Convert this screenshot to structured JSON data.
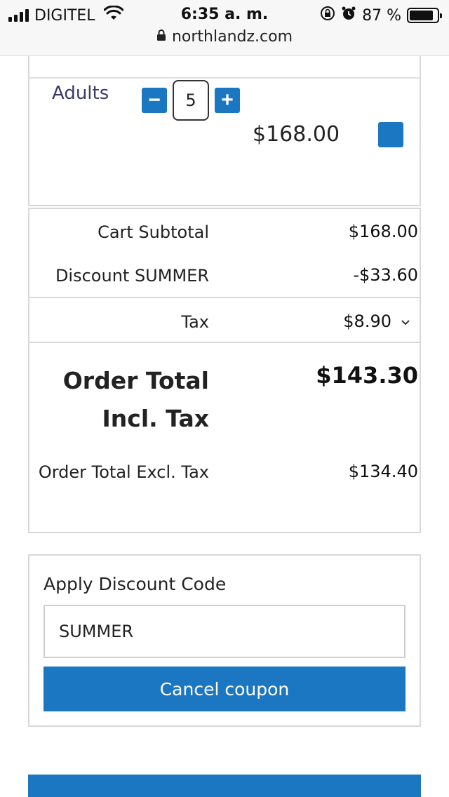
{
  "status_bar": {
    "carrier": "DIGITEL",
    "time": "6:35 a. m.",
    "battery_pct": "87 %",
    "battery_level": 0.87,
    "url": "northlandz.com"
  },
  "item": {
    "label": "Adults",
    "quantity": "5",
    "minus_symbol": "−",
    "plus_symbol": "+",
    "price": "$168.00"
  },
  "totals": {
    "subtotal_label": "Cart Subtotal",
    "subtotal_value": "$168.00",
    "discount_label": "Discount SUMMER",
    "discount_value": "-$33.60",
    "tax_label": "Tax",
    "tax_value": "$8.90",
    "order_total_incl_label": "Order Total Incl. Tax",
    "order_total_incl_value": "$143.30",
    "order_total_excl_label": "Order Total Excl. Tax",
    "order_total_excl_value": "$134.40"
  },
  "coupon": {
    "title": "Apply Discount Code",
    "code_value": "SUMMER",
    "cancel_label": "Cancel coupon"
  },
  "icons": {
    "signal": "signal-icon",
    "wifi": "wifi-icon",
    "rotation_lock": "rotation-lock-icon",
    "alarm": "alarm-icon",
    "battery": "battery-icon",
    "lock": "lock-icon",
    "chevron": "chevron-down-icon"
  },
  "colors": {
    "accent": "#1c77c3"
  }
}
